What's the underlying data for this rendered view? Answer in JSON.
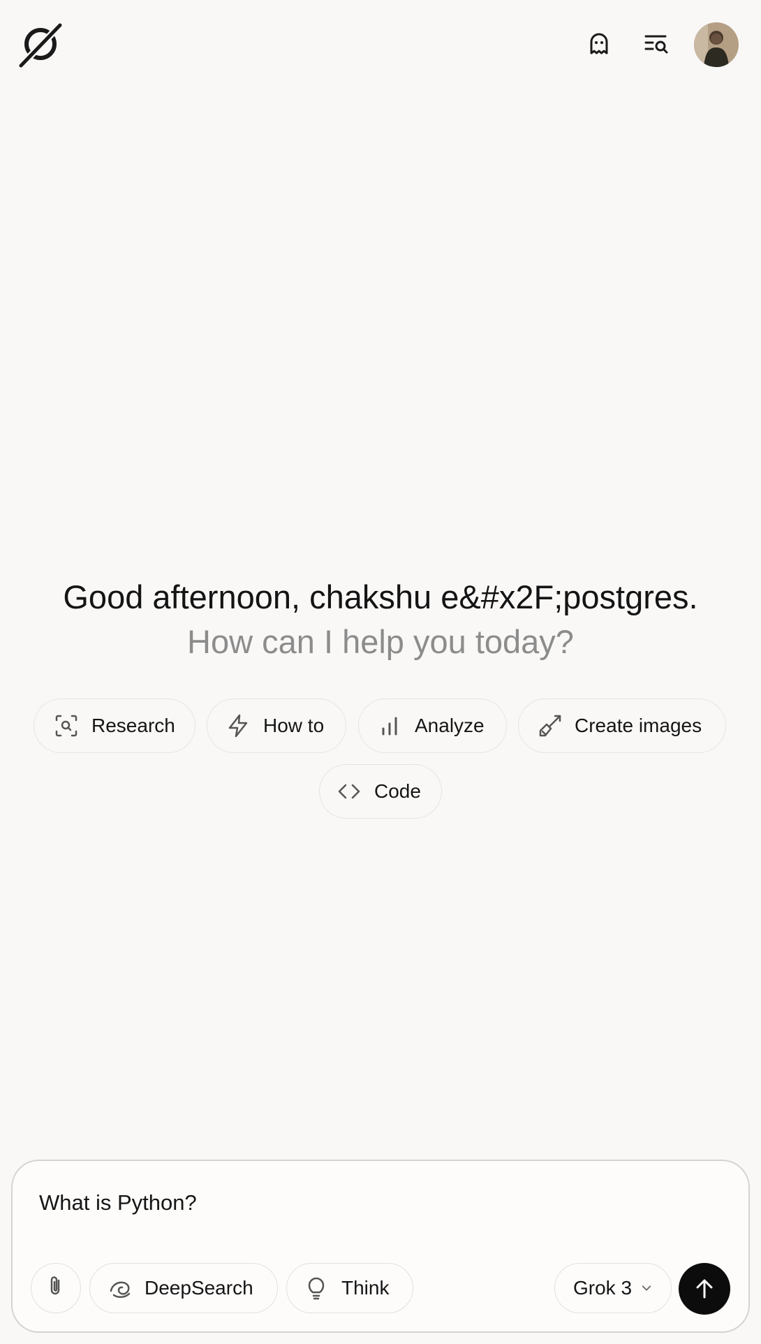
{
  "header": {
    "logo": "grok-logo-icon",
    "private_chat_icon": "ghost-icon",
    "history_icon": "history-search-icon",
    "avatar": "user-avatar"
  },
  "greeting": {
    "line1": "Good afternoon, chakshu e&#x2F;postgres.",
    "line2": "How can I help you today?"
  },
  "chips": [
    {
      "label": "Research",
      "icon": "search-frame-icon"
    },
    {
      "label": "How to",
      "icon": "lightning-icon"
    },
    {
      "label": "Analyze",
      "icon": "bar-chart-icon"
    },
    {
      "label": "Create images",
      "icon": "paintbrush-icon"
    },
    {
      "label": "Code",
      "icon": "code-brackets-icon"
    }
  ],
  "composer": {
    "prompt": "What is Python?",
    "attach_icon": "paperclip-icon",
    "deepsearch_label": "DeepSearch",
    "think_label": "Think",
    "model_label": "Grok 3",
    "send_icon": "arrow-up-icon"
  },
  "colors": {
    "background": "#f9f8f7",
    "text": "#141414",
    "muted": "#8c8c8c",
    "send_button": "#0c0c0c"
  }
}
